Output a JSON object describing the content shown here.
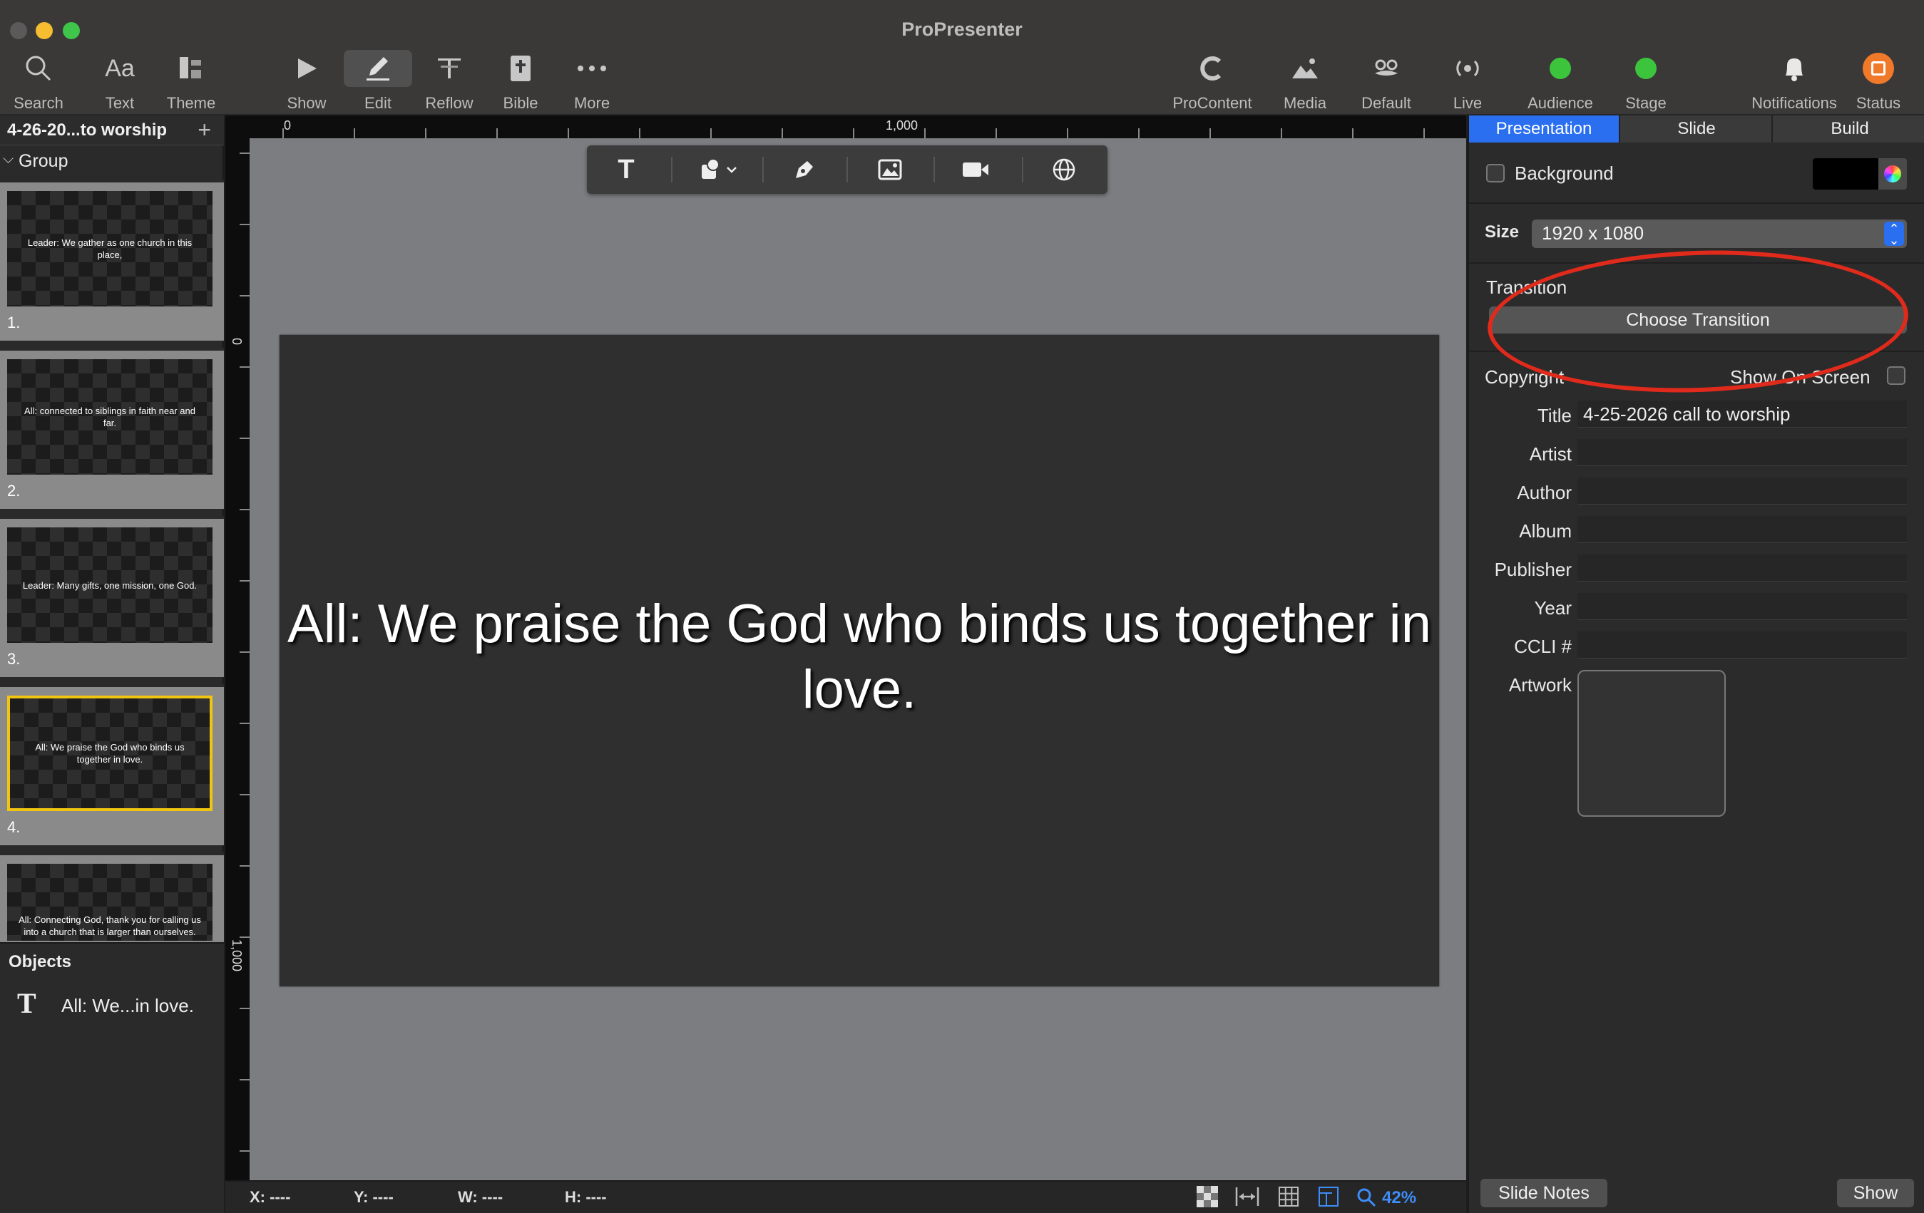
{
  "app": {
    "title": "ProPresenter"
  },
  "colors": {
    "accent": "#2a6ff0",
    "audience_status": "#3cc43c",
    "stage_status": "#3cc43c",
    "status_badge": "#f07a2a",
    "selection": "#f1c40f",
    "annotation": "#e02a1b"
  },
  "toolbar": {
    "search": {
      "label": "Search",
      "icon": "search-icon"
    },
    "text": {
      "label": "Text",
      "icon_text": "Aa"
    },
    "theme": {
      "label": "Theme",
      "icon": "theme-icon"
    },
    "show": {
      "label": "Show",
      "icon": "play-icon"
    },
    "edit": {
      "label": "Edit",
      "icon": "pencil-icon"
    },
    "reflow": {
      "label": "Reflow",
      "icon": "reflow-icon"
    },
    "bible": {
      "label": "Bible",
      "icon": "bible-icon"
    },
    "more": {
      "label": "More",
      "icon": "ellipsis-icon"
    },
    "procontent": {
      "label": "ProContent",
      "icon": "procontent-icon"
    },
    "media": {
      "label": "Media",
      "icon": "media-icon"
    },
    "default": {
      "label": "Default",
      "icon": "mustache-icon"
    },
    "live": {
      "label": "Live",
      "icon": "broadcast-icon"
    },
    "audience": {
      "label": "Audience",
      "icon": "status-dot"
    },
    "stage": {
      "label": "Stage",
      "icon": "status-dot"
    },
    "notifications": {
      "label": "Notifications",
      "icon": "bell-icon"
    },
    "status": {
      "label": "Status",
      "icon": "status-icon"
    }
  },
  "playlist": {
    "title": "4-26-20...to worship",
    "group": "Group",
    "slides": [
      {
        "num": "1.",
        "text": "Leader: We gather as one church in this place,"
      },
      {
        "num": "2.",
        "text": "All: connected to siblings in faith near and far."
      },
      {
        "num": "3.",
        "text": "Leader: Many gifts, one mission, one God."
      },
      {
        "num": "4.",
        "text": "All: We praise the God who binds us together in love."
      },
      {
        "num": "5.",
        "text": "All: Connecting God, thank you for calling us into a church that is larger than ourselves."
      }
    ]
  },
  "objects": {
    "title": "Objects",
    "item_label": "All: We...in love.",
    "item_icon_text": "T"
  },
  "ruler": {
    "top_labels": [
      "0",
      "1,000"
    ],
    "left_labels": [
      "0",
      "1,000"
    ]
  },
  "canvas": {
    "slide_text": "All: We praise the God who binds us together in love.",
    "insert_tools": [
      "text-tool-icon",
      "shape-tool-icon",
      "pen-tool-icon",
      "image-tool-icon",
      "video-tool-icon",
      "web-tool-icon"
    ],
    "text_tool_glyph": "T"
  },
  "statusbar": {
    "x": "X: ----",
    "y": "Y: ----",
    "w": "W: ----",
    "h": "H: ----",
    "zoom": "42%"
  },
  "inspector": {
    "tabs": [
      "Presentation",
      "Slide",
      "Build"
    ],
    "background_label": "Background",
    "size_label": "Size",
    "size_value": "1920 x 1080",
    "transition_label": "Transition",
    "choose_transition": "Choose Transition",
    "copyright_label": "Copyright",
    "show_on_screen": "Show On Screen",
    "fields": [
      {
        "label": "Title",
        "value": "4-25-2026 call to worship"
      },
      {
        "label": "Artist",
        "value": ""
      },
      {
        "label": "Author",
        "value": ""
      },
      {
        "label": "Album",
        "value": ""
      },
      {
        "label": "Publisher",
        "value": ""
      },
      {
        "label": "Year",
        "value": ""
      },
      {
        "label": "CCLI #",
        "value": ""
      }
    ],
    "artwork_label": "Artwork",
    "slide_notes": "Slide Notes",
    "show": "Show"
  }
}
